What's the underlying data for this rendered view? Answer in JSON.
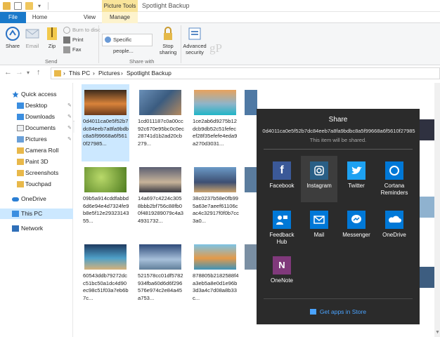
{
  "window": {
    "title": "Spotlight Backup",
    "context_tab_group": "Picture Tools",
    "watermark": "gP"
  },
  "tabs": {
    "file": "File",
    "home": "Home",
    "share": "Share",
    "view": "View",
    "manage": "Manage"
  },
  "ribbon": {
    "share": "Share",
    "email": "Email",
    "zip": "Zip",
    "burn": "Burn to disc",
    "print": "Print",
    "fax": "Fax",
    "send_group": "Send",
    "share_combo": "Specific people...",
    "stop_sharing": "Stop sharing",
    "advanced_security": "Advanced security",
    "share_with_group": "Share with"
  },
  "address": {
    "crumbs": [
      "This PC",
      "Pictures",
      "Spotlight Backup"
    ]
  },
  "nav": {
    "quick_access": "Quick access",
    "items": [
      "Desktop",
      "Downloads",
      "Documents",
      "Pictures",
      "Camera Roll",
      "Paint 3D",
      "Screenshots",
      "Touchpad"
    ],
    "onedrive": "OneDrive",
    "this_pc": "This PC",
    "network": "Network"
  },
  "files": [
    {
      "name": "0d4011ca0e5f52b7dc84eeb7a8fa9bdbc8a5f99668a6f5610f27985..."
    },
    {
      "name": "1cd011187c0a00cc92c670e95bc0c0ec28741d1b2ad20cb279..."
    },
    {
      "name": "1ce2ab6d9275b12dcb9db52c51fefecef28f35efefe4eda9a270d3031..."
    },
    {
      "name": "09b5a914cddfabbd6d6e94e4d7324fe9b8e5f12e2932314355..."
    },
    {
      "name": "14a697c4224c3058bbb2bf756c88fb00f48192890​79c4a34931732..."
    },
    {
      "name": "38c0237b58e0fb995a63e7aeef61106cac4c32917f0f0b7cc3a0..."
    },
    {
      "name": "60543ddb79272dcc51bc50a1dc4d90ec98c51f03a7eb6b7c..."
    },
    {
      "name": "521578cc01df5782934fba60d6d6f296576e974c2e84a45a753..."
    },
    {
      "name": "878805b2182588f4a3eb5a8e0d1e96b3d3a4c7d08a8b33c..."
    }
  ],
  "files_display": [
    "0d4011ca0e5f52b7dc84eeb7a8fa9bdbc8a5f99668a6f5610f27985...",
    "1cd011187c0a00cc92c670e95bc0c0ec28741d1b2ad20cb279...",
    "1ce2ab6d9275b12dcb9db52c51fefecef28f35efefe4eda9a270d3031...",
    "09b5a914cddfabbd6d6e94e4d7324fe9b8e5f12e2932314355...",
    "14a697c4224c3058bbb2bf756c88fb00f4819289079c4a34931732...",
    "38c0237b58e0fb995a63e7aeef61106cac4c32917f0f0b7cc3a0...",
    "60543ddb79272dcc51bc50a1dc4d90ec98c51f03a7eb6b7c...",
    "521578cc01df5782934fba60d6d6f296576e974c2e84a45a753...",
    "878805b2182588f4a3eb5a8e0d1e96b3d3a4c7d08a8b33c..."
  ],
  "share_panel": {
    "title": "Share",
    "file_name": "0d4011ca0e5f52b7dc84eeb7a8fa9bdbc8a5f99668a6f5610f27985",
    "subtitle": "This item will be shared.",
    "apps": [
      "Facebook",
      "Instagram",
      "Twitter",
      "Cortana Reminders",
      "Feedback Hub",
      "Mail",
      "Messenger",
      "OneDrive",
      "OneNote"
    ],
    "store_link": "Get apps in Store"
  },
  "colors": {
    "accent": "#1979ca",
    "panel": "#2b2b2b",
    "selection": "#cce8ff"
  }
}
